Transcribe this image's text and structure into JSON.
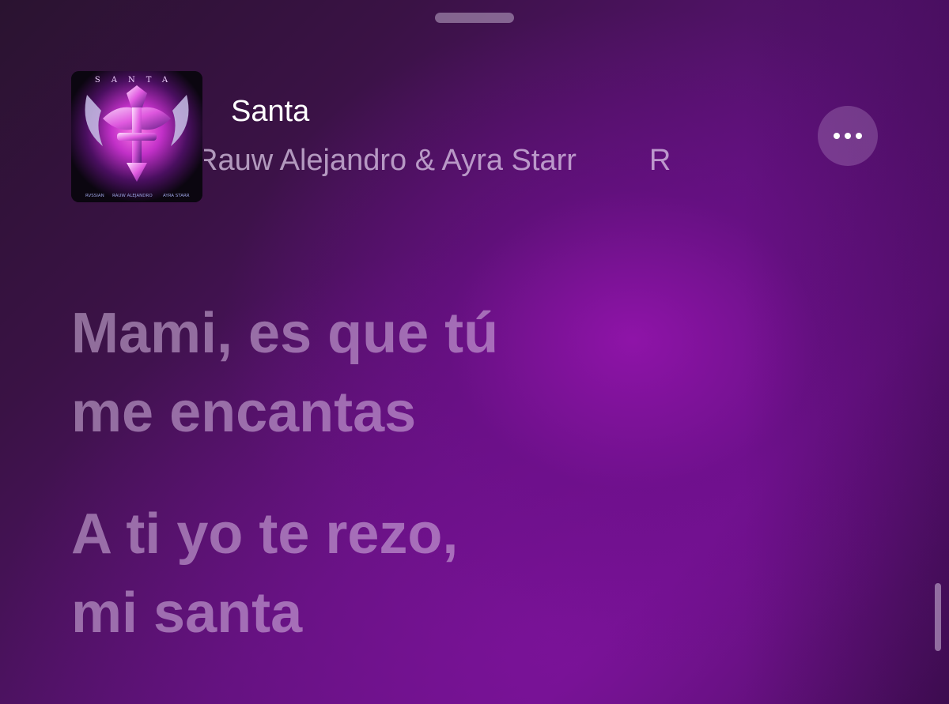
{
  "now_playing": {
    "title": "Santa",
    "artist": "Rauw Alejandro & Ayra Starr",
    "artist_next_fragment": "R",
    "more_icon": "ellipsis-icon"
  },
  "artwork": {
    "title_text": "SANTA",
    "credits": [
      "RVSSIAN",
      "RAUW ALEJANDRO",
      "AYRA STARR"
    ]
  },
  "lyrics": [
    {
      "lines": [
        "Mami, es que tú",
        "me encantas"
      ]
    },
    {
      "lines": [
        "A ti yo te rezo,",
        "mi santa"
      ]
    }
  ],
  "colors": {
    "background": "#5a1275",
    "lyric_text": "#d7b9e1",
    "title_text": "#ffffff"
  }
}
